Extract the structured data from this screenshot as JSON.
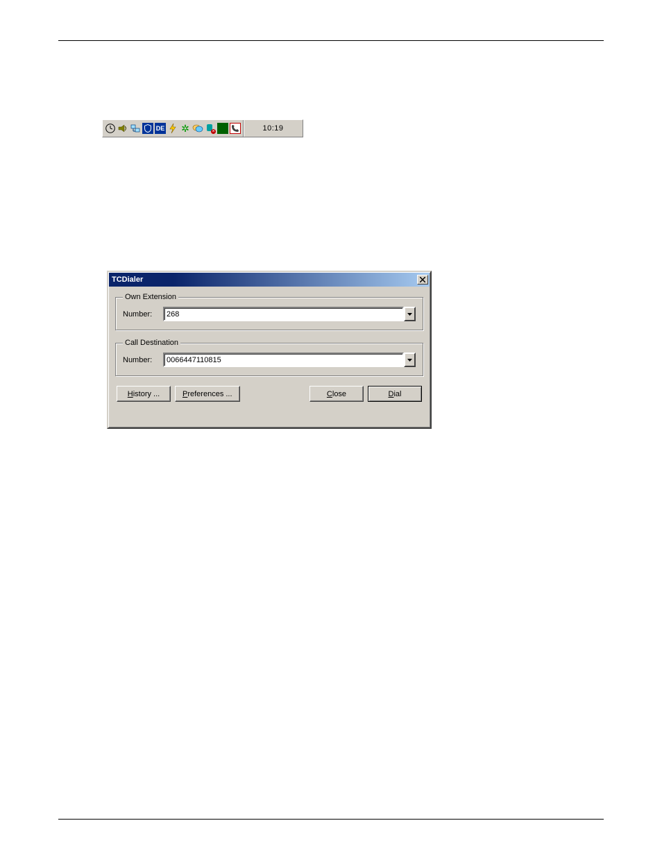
{
  "tray": {
    "clock_time": "10:19",
    "lang_code": "DE",
    "icons": [
      {
        "name": "clock-icon"
      },
      {
        "name": "volume-icon"
      },
      {
        "name": "network-icon"
      },
      {
        "name": "shield-icon"
      },
      {
        "name": "language-icon"
      },
      {
        "name": "bolt-icon"
      },
      {
        "name": "icq-icon"
      },
      {
        "name": "chat-icon"
      },
      {
        "name": "person-offline-icon"
      },
      {
        "name": "status-green-icon"
      },
      {
        "name": "phone-icon"
      }
    ]
  },
  "dialer": {
    "title": "TCDialer",
    "group_own": "Own Extension",
    "group_dest": "Call Destination",
    "number_label": "Number:",
    "own_number": "268",
    "dest_number": "0066447110815",
    "buttons": {
      "history_ul": "H",
      "history_rest": "istory ...",
      "prefs_ul": "P",
      "prefs_rest": "references ...",
      "close_ul": "C",
      "close_rest": "lose",
      "dial_ul": "D",
      "dial_rest": "ial"
    }
  }
}
